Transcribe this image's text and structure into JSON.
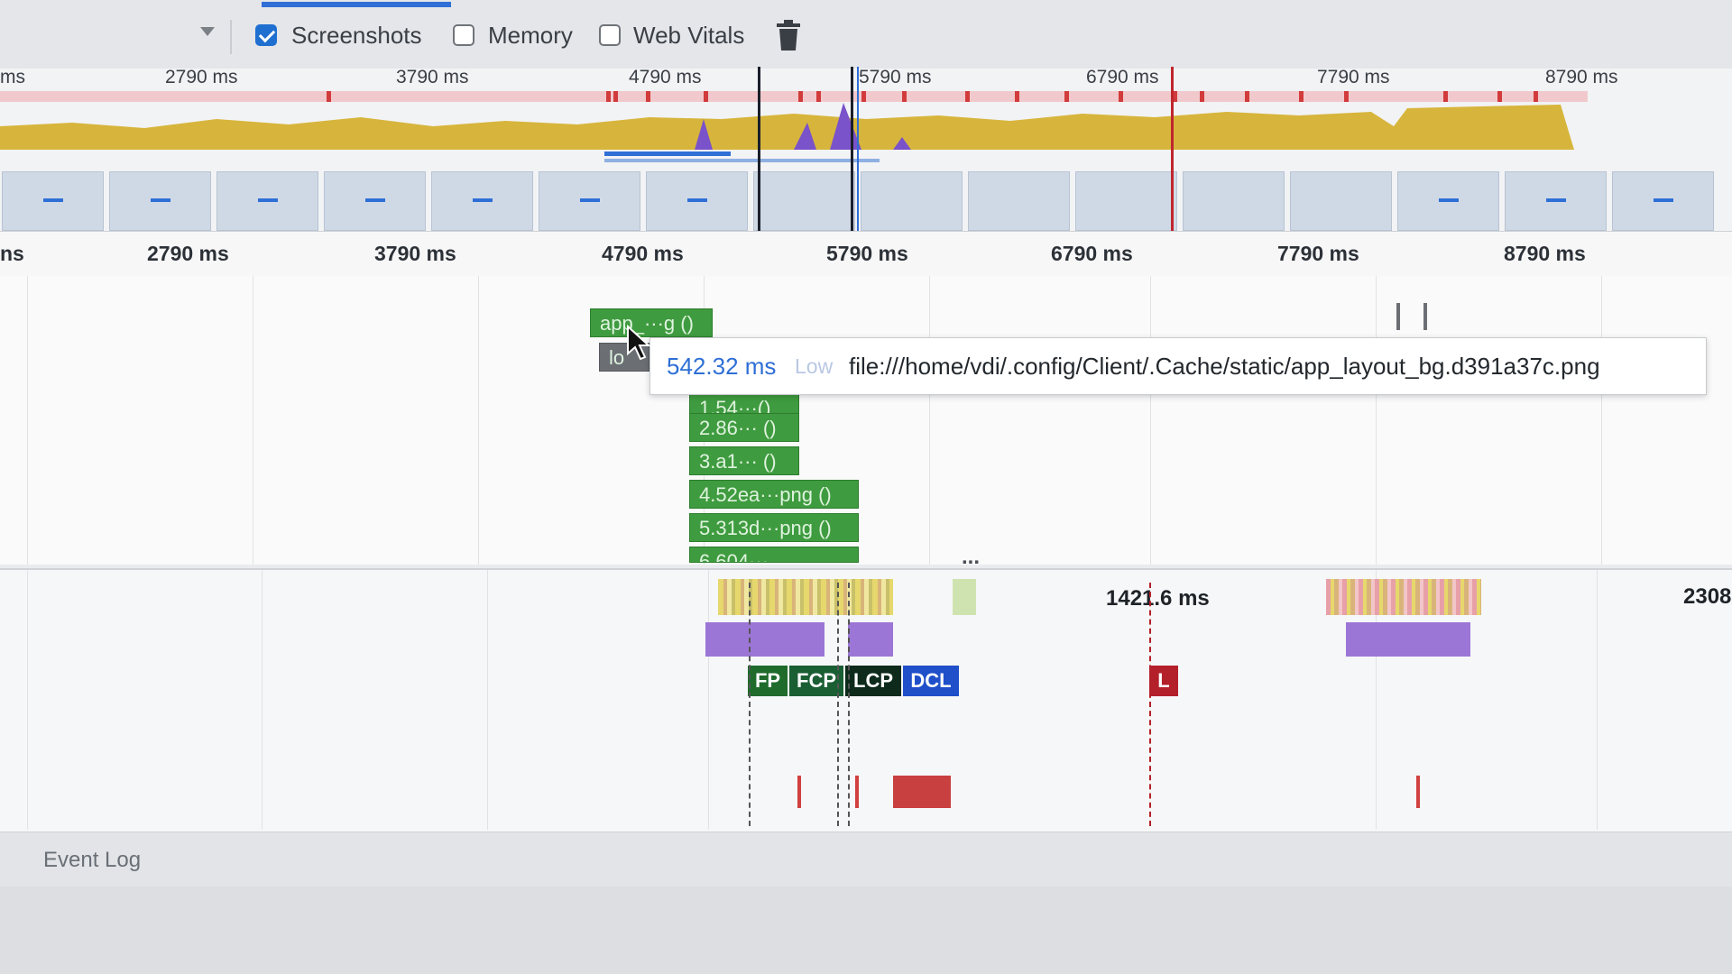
{
  "toolbar": {
    "checkboxes": [
      {
        "label": "Screenshots",
        "checked": true
      },
      {
        "label": "Memory",
        "checked": false
      },
      {
        "label": "Web Vitals",
        "checked": false
      }
    ],
    "trash_icon": "trash-icon"
  },
  "overview": {
    "tick_partial": "ms",
    "ticks": [
      "2790 ms",
      "3790 ms",
      "4790 ms",
      "5790 ms",
      "6790 ms",
      "7790 ms",
      "8790 ms"
    ]
  },
  "ruler": {
    "tick_partial": "ns",
    "ticks": [
      "2790 ms",
      "3790 ms",
      "4790 ms",
      "5790 ms",
      "6790 ms",
      "7790 ms",
      "8790 ms"
    ]
  },
  "flame": {
    "bars": [
      "app_···g ()",
      "lo",
      "1.54···()",
      "2.86··· ()",
      "3.a1··· ()",
      "4.52ea···png ()",
      "5.313d···png ()",
      "6.604···"
    ],
    "overflow_dots": "..."
  },
  "tooltip": {
    "time": "542.32 ms",
    "priority": "Low",
    "url": "file:///home/vdi/.config/Client/.Cache/static/app_layout_bg.d391a37c.png"
  },
  "timings": {
    "center_time": "1421.6 ms",
    "right_time": "2308",
    "markers": {
      "fp": "FP",
      "fcp": "FCP",
      "lcp": "LCP",
      "dcl": "DCL",
      "l": "L"
    }
  },
  "colors": {
    "accent": "#2f6fd6",
    "flame_green": "#3f9b3f",
    "fp": "#1f6b2c",
    "fcp": "#1a5e33",
    "lcp": "#0d2a1a",
    "dcl": "#1f4fc9",
    "load": "#b3202a"
  },
  "bottom": {
    "event_log": "Event Log"
  }
}
